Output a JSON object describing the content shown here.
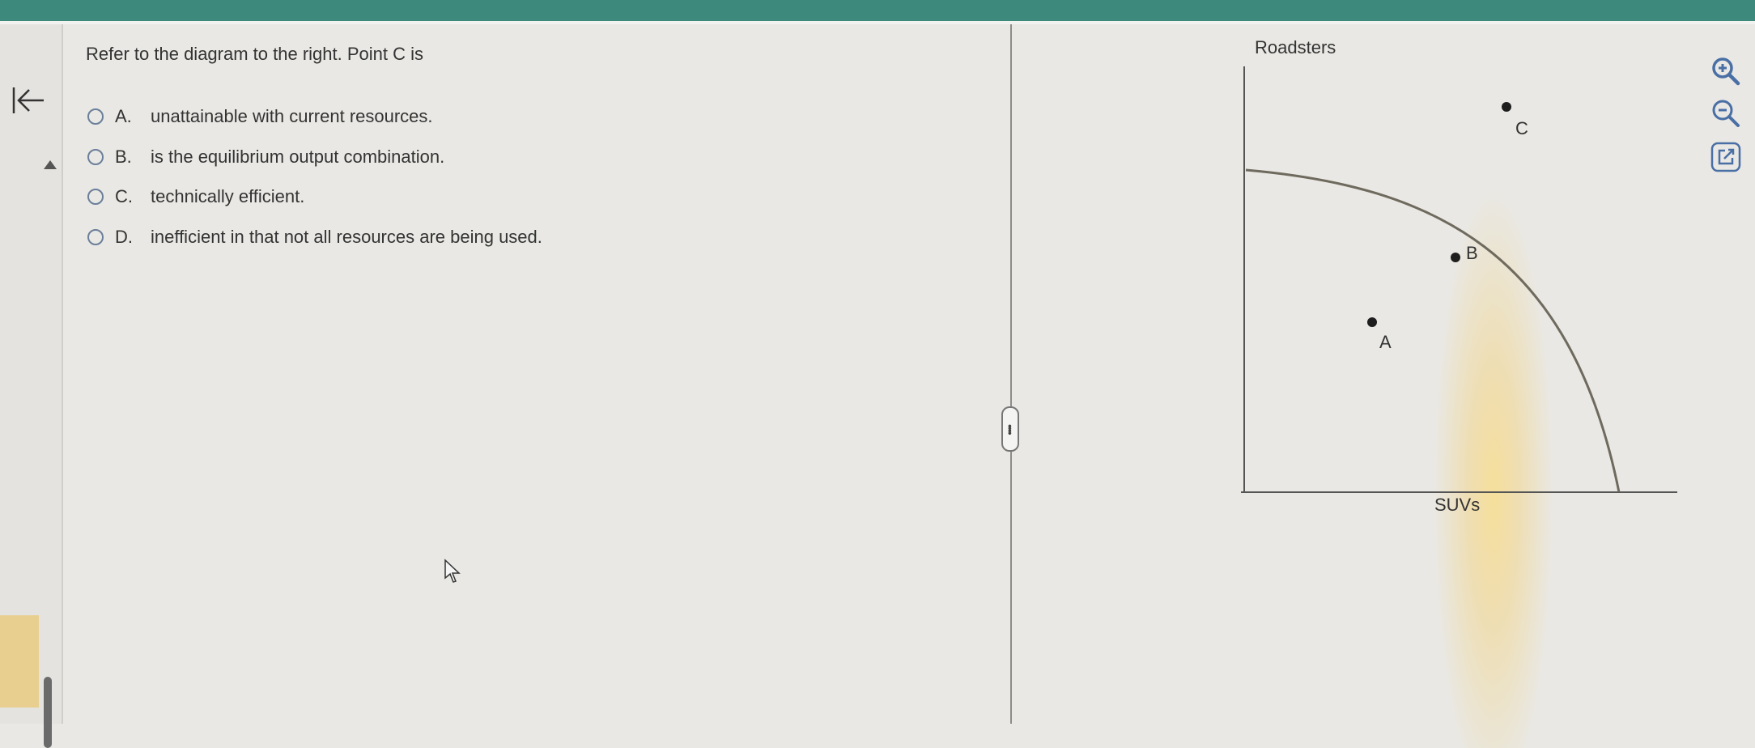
{
  "question": {
    "prompt": "Refer to the diagram to the right. Point C is",
    "options": [
      {
        "letter": "A.",
        "text": "unattainable with current resources."
      },
      {
        "letter": "B.",
        "text": "is the equilibrium output combination."
      },
      {
        "letter": "C.",
        "text": "technically efficient."
      },
      {
        "letter": "D.",
        "text": "inefficient in that not all resources are being used."
      }
    ]
  },
  "graph": {
    "y_axis_label": "Roadsters",
    "x_axis_label": "SUVs",
    "points": [
      {
        "label": "A"
      },
      {
        "label": "B"
      },
      {
        "label": "C"
      }
    ]
  },
  "tools": {
    "zoom_in_icon": "zoom-in-icon",
    "zoom_out_icon": "zoom-out-icon",
    "popout_icon": "external-link-icon"
  },
  "colors": {
    "topbar": "#3d8a7c",
    "curve": "#6f6a5e",
    "radio": "#6a7f9a",
    "tool_icon": "#4a6fa5"
  }
}
